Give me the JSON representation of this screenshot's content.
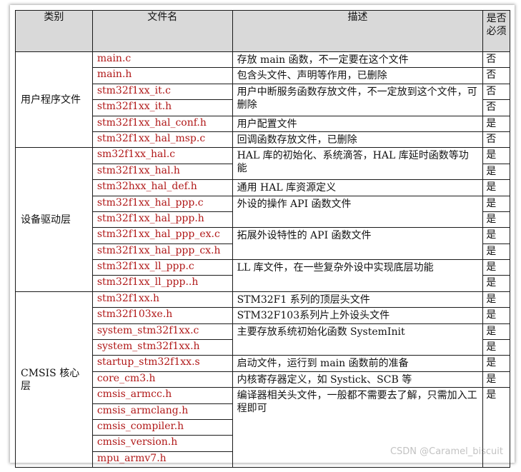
{
  "headers": {
    "category": "类别",
    "filename": "文件名",
    "description": "描述",
    "required": "是否必须"
  },
  "groups": [
    {
      "category": "用户程序文件",
      "blocks": [
        {
          "files": [
            "main.c"
          ],
          "desc": "存放 main 函数，不一定要在这个文件",
          "req": [
            "否"
          ]
        },
        {
          "files": [
            "main.h"
          ],
          "desc": "包含头文件、声明等作用，已删除",
          "req": [
            "否"
          ]
        },
        {
          "files": [
            "stm32f1xx_it.c",
            "stm32f1xx_it.h"
          ],
          "desc": "用户中断服务函数存放文件，不一定放到这个文件，可删除",
          "req": [
            "否",
            "否"
          ]
        },
        {
          "files": [
            "stm32f1xx_hal_conf.h"
          ],
          "desc": "用户配置文件",
          "req": [
            "是"
          ]
        },
        {
          "files": [
            "stm32f1xx_hal_msp.c"
          ],
          "desc": "回调函数存放文件，已删除",
          "req": [
            "否"
          ]
        }
      ]
    },
    {
      "category": "设备驱动层",
      "blocks": [
        {
          "files": [
            "sm32f1xx_hal.c",
            "stm32f1xx_hal.h"
          ],
          "desc": "HAL 库的初始化、系统滴答，HAL 库延时函数等功能",
          "req": [
            "是",
            "是"
          ]
        },
        {
          "files": [
            "stm32hxx_hal_def.h"
          ],
          "desc": "通用 HAL 库资源定义",
          "req": [
            "是"
          ]
        },
        {
          "files": [
            "stm32f1xx_hal_ppp.c",
            "stm32f1xx_hal_ppp.h"
          ],
          "desc": "外设的操作 API 函数文件",
          "req": [
            "是",
            "是"
          ]
        },
        {
          "files": [
            "stm32f1xx_hal_ppp_ex.c",
            "stm32f1xx_hal_ppp_cx.h"
          ],
          "desc": "拓展外设特性的 API 函数文件",
          "req": [
            "是",
            "是"
          ]
        },
        {
          "files": [
            "stm32f1xx_ll_ppp.c",
            "stm32f1xx_ll_ppp..h"
          ],
          "desc": "LL 库文件，在一些复杂外设中实现底层功能",
          "req": [
            "是",
            "是"
          ]
        }
      ]
    },
    {
      "category": "CMSIS 核心层",
      "blocks": [
        {
          "files": [
            "stm32f1xx.h"
          ],
          "desc": "STM32F1 系列的顶层头文件",
          "req": [
            "是"
          ]
        },
        {
          "files": [
            "stm32f103xe.h"
          ],
          "desc": "STM32F103系列片上外设头文件",
          "req": [
            "是"
          ]
        },
        {
          "files": [
            "system_stm32f1xx.c",
            "system_stm32f1xx.h"
          ],
          "desc": "主要存放系统初始化函数 SystemInit",
          "req": [
            "是",
            "是"
          ]
        },
        {
          "files": [
            "startup_stm32f1xx.s"
          ],
          "desc": "启动文件，运行到 main 函数前的准备",
          "req": [
            "是"
          ]
        },
        {
          "files": [
            "core_cm3.h"
          ],
          "desc": "内核寄存器定义，如 Systick、SCB 等",
          "req": [
            "是"
          ]
        },
        {
          "files": [
            "cmsis_armcc.h",
            "cmsis_armclang.h",
            "cmsis_compiler.h",
            "cmsis_version.h",
            "mpu_armv7.h"
          ],
          "desc": "编译器相关头文件，一般都不需要去了解，只需加入工程即可",
          "req": [
            "是"
          ]
        }
      ]
    }
  ],
  "watermark": "CSDN @Caramel_biscuit"
}
